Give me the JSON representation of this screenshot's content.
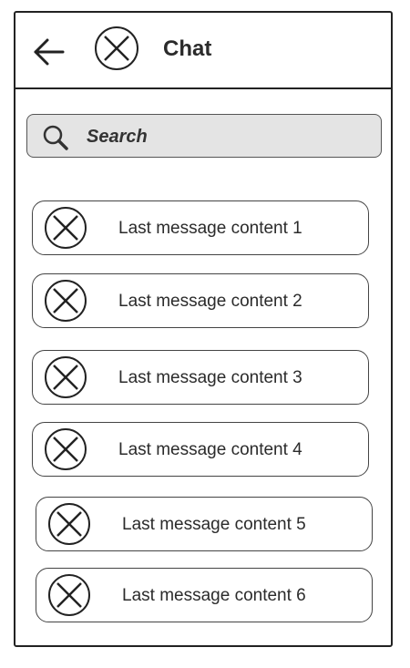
{
  "header": {
    "back_icon": "arrow-left-icon",
    "avatar_icon": "avatar-placeholder-x-icon",
    "title": "Chat"
  },
  "search": {
    "icon": "search-icon",
    "label": "Search",
    "background": "#e4e4e4"
  },
  "chats": [
    {
      "text": "Last message content 1",
      "avatar_icon": "avatar-placeholder-x-icon"
    },
    {
      "text": "Last message content 2",
      "avatar_icon": "avatar-placeholder-x-icon"
    },
    {
      "text": "Last message content 3",
      "avatar_icon": "avatar-placeholder-x-icon"
    },
    {
      "text": "Last message content 4",
      "avatar_icon": "avatar-placeholder-x-icon"
    },
    {
      "text": "Last message content 5",
      "avatar_icon": "avatar-placeholder-x-icon"
    },
    {
      "text": "Last message content 6",
      "avatar_icon": "avatar-placeholder-x-icon"
    }
  ]
}
